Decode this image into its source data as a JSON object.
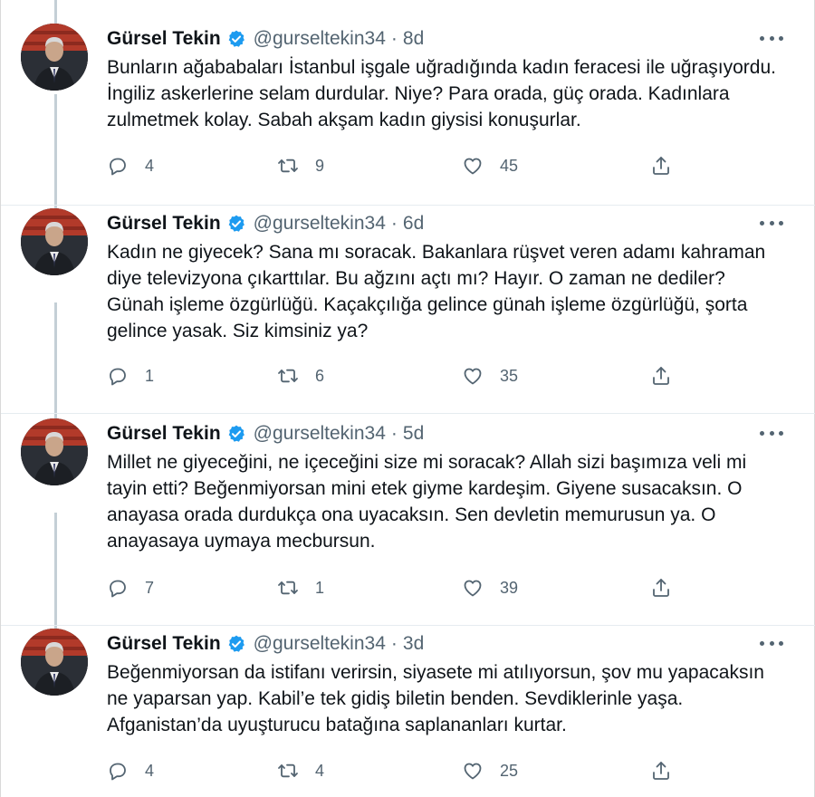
{
  "tweets": [
    {
      "name": "Gürsel Tekin",
      "handle": "@gurseltekin34",
      "time": "8d",
      "text": "Bunların ağababaları İstanbul işgale uğradığında kadın feracesi ile uğraşıyordu. İngiliz askerlerine selam durdular. Niye? Para orada, güç orada. Kadınlara zulmetmek kolay. Sabah akşam kadın giysisi konuşurlar.",
      "replies": "4",
      "retweets": "9",
      "likes": "45"
    },
    {
      "name": "Gürsel Tekin",
      "handle": "@gurseltekin34",
      "time": "6d",
      "text": "Kadın ne giyecek? Sana mı soracak. Bakanlara rüşvet veren adamı kahraman diye televizyona çıkarttılar. Bu ağzını açtı mı? Hayır. O zaman ne dediler? Günah işleme özgürlüğü. Kaçakçılığa gelince günah işleme özgürlüğü, şorta gelince yasak. Siz kimsiniz ya?",
      "replies": "1",
      "retweets": "6",
      "likes": "35"
    },
    {
      "name": "Gürsel Tekin",
      "handle": "@gurseltekin34",
      "time": "5d",
      "text": "Millet ne giyeceğini, ne içeceğini size  mi soracak? Allah sizi başımıza veli mi tayin etti? Beğenmiyorsan mini etek giyme kardeşim. Giyene susacaksın. O anayasa orada durdukça ona uyacaksın. Sen devletin memurusun ya. O anayasaya uymaya mecbursun.",
      "replies": "7",
      "retweets": "1",
      "likes": "39"
    },
    {
      "name": "Gürsel Tekin",
      "handle": "@gurseltekin34",
      "time": "3d",
      "text": "Beğenmiyorsan da istifanı verirsin, siyasete mi atılıyorsun, şov mu yapacaksın ne yaparsan yap. Kabil’e tek gidiş biletin benden. Sevdiklerinle yaşa. Afganistan’da uyuşturucu batağına saplananları kurtar.",
      "replies": "4",
      "retweets": "4",
      "likes": "25"
    }
  ],
  "icons": {
    "reply": "reply-icon",
    "retweet": "retweet-icon",
    "like": "like-icon",
    "share": "share-icon",
    "verified": "verified-badge-icon",
    "more": "more-options-icon"
  },
  "colors": {
    "text": "#0f1419",
    "secondary": "#536471",
    "verified": "#1d9bf0",
    "thread_line": "#c4cfd6"
  }
}
